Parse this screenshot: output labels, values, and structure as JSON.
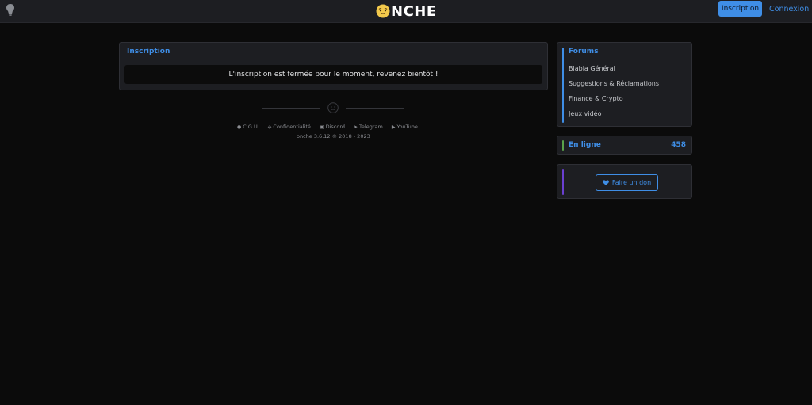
{
  "header": {
    "logo_text": "NCHE",
    "inscription_label": "Inscription",
    "connexion_label": "Connexion"
  },
  "main": {
    "title": "Inscription",
    "notice": "L'inscription est fermée pour le moment, revenez bientôt !"
  },
  "footer": {
    "links": [
      {
        "icon": "globe-icon",
        "label": "C.G.U."
      },
      {
        "icon": "shield-icon",
        "label": "Confidentialité"
      },
      {
        "icon": "discord-icon",
        "label": "Discord"
      },
      {
        "icon": "telegram-icon",
        "label": "Telegram"
      },
      {
        "icon": "youtube-icon",
        "label": "YouTube"
      }
    ],
    "version": "onche 3.6.12 © 2018 - 2023"
  },
  "sidebar": {
    "forums_title": "Forums",
    "forums": [
      {
        "label": "Blabla Général"
      },
      {
        "label": "Suggestions & Réclamations"
      },
      {
        "label": "Finance & Crypto"
      },
      {
        "label": "Jeux vidéo"
      }
    ],
    "online_title": "En ligne",
    "online_count": "458",
    "donate_label": "Faire un don"
  },
  "colors": {
    "accent": "#3f8ee6",
    "background": "#0b0b0b",
    "card": "#1d1e22",
    "online_accent": "#5aa34a",
    "donate_accent": "#6a3fd0"
  }
}
